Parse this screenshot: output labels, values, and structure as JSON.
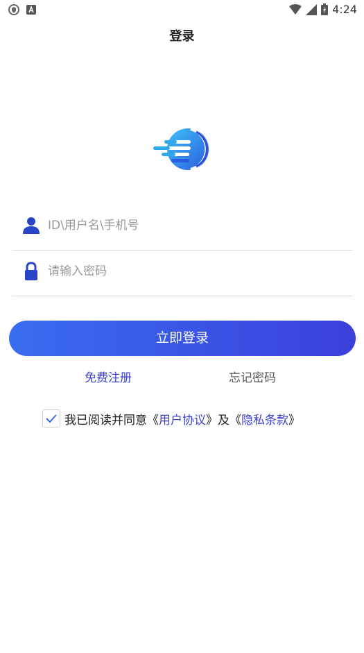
{
  "status": {
    "time": "4:24"
  },
  "header": {
    "title": "登录"
  },
  "form": {
    "username_placeholder": "ID\\用户名\\手机号",
    "password_placeholder": "请输入密码",
    "login_label": "立即登录"
  },
  "links": {
    "register": "免费注册",
    "forgot": "忘记密码"
  },
  "agreement": {
    "checked": true,
    "prefix": "我已阅读并同意",
    "open1": "《",
    "user_agreement": "用户协议",
    "close1": "》",
    "and": "及",
    "open2": "《",
    "privacy": "隐私条款",
    "close2": "》"
  },
  "colors": {
    "accent": "#3b3fd0",
    "button_start": "#3a6df0",
    "button_end": "#3b3fdc"
  }
}
